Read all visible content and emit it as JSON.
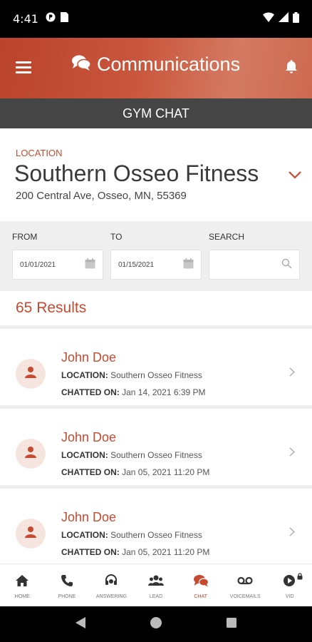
{
  "status_bar": {
    "time": "4:41",
    "icons": [
      "notification-icon",
      "sim-icon",
      "wifi-icon",
      "signal-icon",
      "battery-icon"
    ]
  },
  "header": {
    "title": "Communications",
    "color": "#c0492f",
    "icons": {
      "menu": "menu-icon",
      "chat": "chat-bubbles-icon",
      "bell": "bell-icon"
    }
  },
  "subheader": {
    "title": "GYM CHAT",
    "color": "#454545"
  },
  "location": {
    "label": "LOCATION",
    "name": "Southern Osseo Fitness",
    "address": "200 Central Ave, Osseo, MN, 55369"
  },
  "filters": {
    "from": {
      "label": "FROM",
      "value": "01/01/2021"
    },
    "to": {
      "label": "TO",
      "value": "01/15/2021"
    },
    "search": {
      "label": "SEARCH",
      "value": "",
      "placeholder": ""
    }
  },
  "results": {
    "text": "65 Results"
  },
  "chats": [
    {
      "name": "John Doe",
      "location_label": "LOCATION:",
      "location": "Southern Osseo Fitness",
      "chatted_label": "CHATTED ON:",
      "chatted_on": "Jan 14, 2021 6:39 PM"
    },
    {
      "name": "John Doe",
      "location_label": "LOCATION:",
      "location": "Southern Osseo Fitness",
      "chatted_label": "CHATTED ON:",
      "chatted_on": "Jan 05, 2021 11:20 PM"
    },
    {
      "name": "John Doe",
      "location_label": "LOCATION:",
      "location": "Southern Osseo Fitness",
      "chatted_label": "CHATTED ON:",
      "chatted_on": "Jan 05, 2021 11:20 PM"
    }
  ],
  "tabs": [
    {
      "label": "HOME",
      "icon": "home-icon"
    },
    {
      "label": "PHONE",
      "icon": "phone-icon"
    },
    {
      "label": "ANSWERING",
      "icon": "headset-icon"
    },
    {
      "label": "LEAD",
      "icon": "people-icon"
    },
    {
      "label": "CHAT",
      "icon": "chat-icon",
      "active": true
    },
    {
      "label": "VOICEMAILS",
      "icon": "voicemail-icon"
    },
    {
      "label": "VID",
      "icon": "video-icon"
    }
  ],
  "colors": {
    "accent": "#c54a30",
    "tab_inactive": "#333333",
    "filter_bg": "#efefef"
  }
}
